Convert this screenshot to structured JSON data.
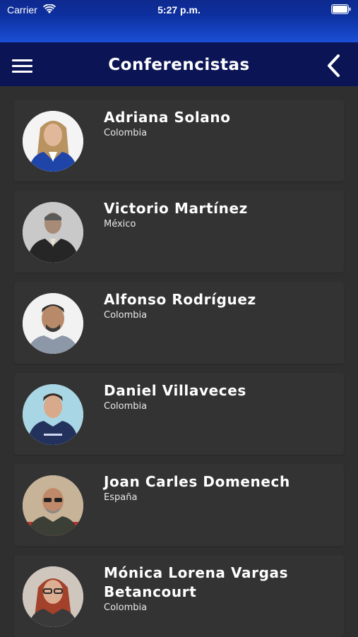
{
  "status_bar": {
    "carrier": "Carrier",
    "time": "5:27 p.m."
  },
  "header": {
    "title": "Conferencistas",
    "menu_icon": "hamburger-menu-icon",
    "back_icon": "chevron-left-icon"
  },
  "colors": {
    "status_bar_blue": "#1a4fd6",
    "nav_bar_navy": "#0b1454",
    "background": "#2f2f2f"
  },
  "speakers": [
    {
      "name": "Adriana Solano",
      "country": "Colombia"
    },
    {
      "name": "Victorio Martínez",
      "country": "México"
    },
    {
      "name": "Alfonso Rodríguez",
      "country": "Colombia"
    },
    {
      "name": "Daniel Villaveces",
      "country": "Colombia"
    },
    {
      "name": "Joan Carles Domenech",
      "country": "España"
    },
    {
      "name": "Mónica Lorena Vargas Betancourt",
      "country": "Colombia"
    }
  ]
}
